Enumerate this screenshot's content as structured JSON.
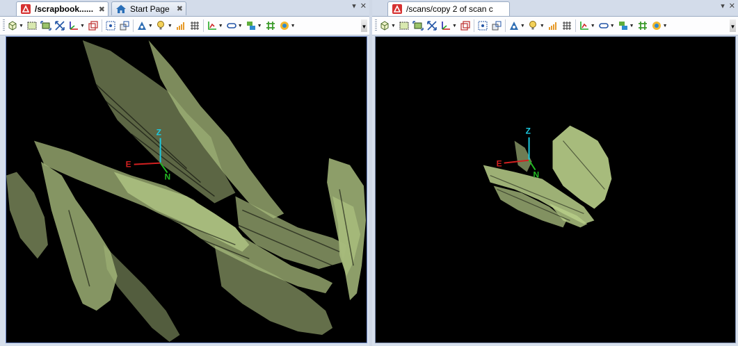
{
  "left_pane": {
    "tabs": [
      {
        "label": "/scrapbook......",
        "active": true
      },
      {
        "label": "Start Page",
        "active": false
      }
    ],
    "axes": {
      "z": "Z",
      "e": "E",
      "n": "N"
    }
  },
  "right_pane": {
    "tabs": [
      {
        "label": "/scans/copy 2 of scan c",
        "active": true
      }
    ],
    "axes": {
      "z": "Z",
      "e": "E",
      "n": "N"
    }
  },
  "window_controls": {
    "dropdown": "▾",
    "close": "✕"
  },
  "toolbar_icons": [
    "view-cube-icon",
    "select-box-icon",
    "fit-selection-icon",
    "zoom-extents-icon",
    "ucs-icon",
    "clip-box-icon",
    "center-point-icon",
    "snap-icon",
    "triangle-icon",
    "light-icon",
    "volume-icon",
    "grid-icon",
    "chart-axis-icon",
    "link-icon",
    "stack-icon",
    "mesh-icon",
    "target-icon"
  ],
  "colors": {
    "point_cloud": "#b9cf8a",
    "z_axis": "#1bc9e0",
    "e_axis": "#d22020",
    "n_axis": "#22b822",
    "accent_border": "#6b86c6"
  }
}
